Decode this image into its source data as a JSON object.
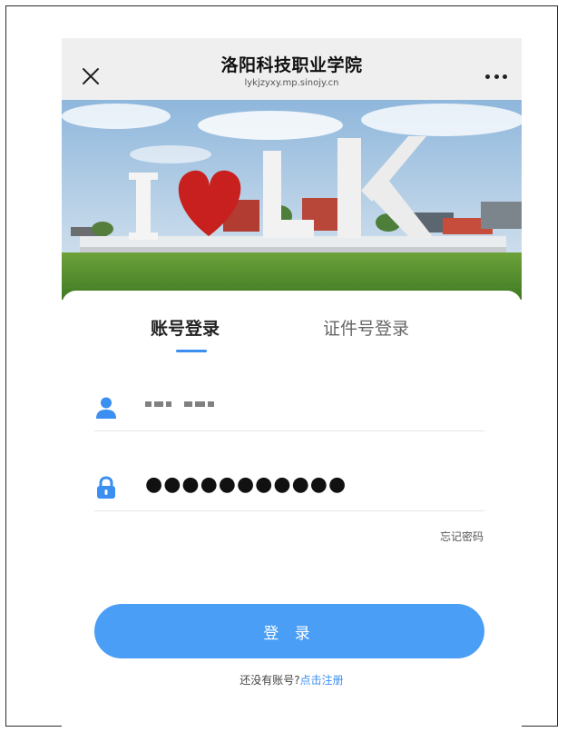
{
  "header": {
    "title": "洛阳科技职业学院",
    "subtitle": "lykjzyxy.mp.sinojy.cn",
    "close_icon": "close-icon",
    "more_icon": "more-icon"
  },
  "banner": {
    "image": "campus-ilk-sculpture",
    "slides_total": 1,
    "slide_index": 1
  },
  "tabs": [
    {
      "label": "账号登录",
      "active": true
    },
    {
      "label": "证件号登录",
      "active": false
    }
  ],
  "form": {
    "account": {
      "icon": "user-icon"
    },
    "password": {
      "icon": "lock-icon",
      "masked_value": "●●●●●●●●●●●"
    },
    "forgot_label": "忘记密码"
  },
  "login_button": "登 录",
  "register": {
    "prompt": "还没有账号?",
    "link": "点击注册"
  },
  "colors": {
    "accent": "#3a8ff0",
    "button": "#4a9ef5",
    "titlebar_bg": "#efefef"
  }
}
